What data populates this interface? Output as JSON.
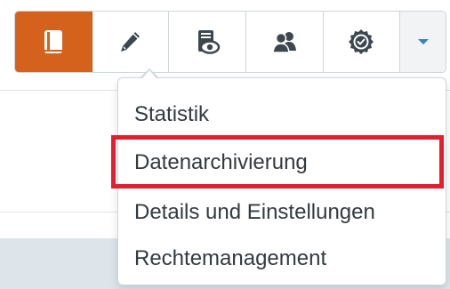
{
  "toolbar": {
    "buttons": [
      {
        "icon": "book-icon",
        "active": true
      },
      {
        "icon": "pencil-icon",
        "active": false
      },
      {
        "icon": "document-eye-icon",
        "active": false
      },
      {
        "icon": "users-icon",
        "active": false
      },
      {
        "icon": "badge-check-icon",
        "active": false
      },
      {
        "icon": "caret-down-icon",
        "active": false
      }
    ],
    "accent_color": "#d4621d"
  },
  "menu": {
    "items": [
      {
        "label": "Statistik"
      },
      {
        "label": "Datenarchivierung",
        "highlighted": true
      },
      {
        "label": "Details und Einstellungen"
      },
      {
        "label": "Rechtemanagement"
      }
    ],
    "highlight_color": "#e41e2f"
  }
}
